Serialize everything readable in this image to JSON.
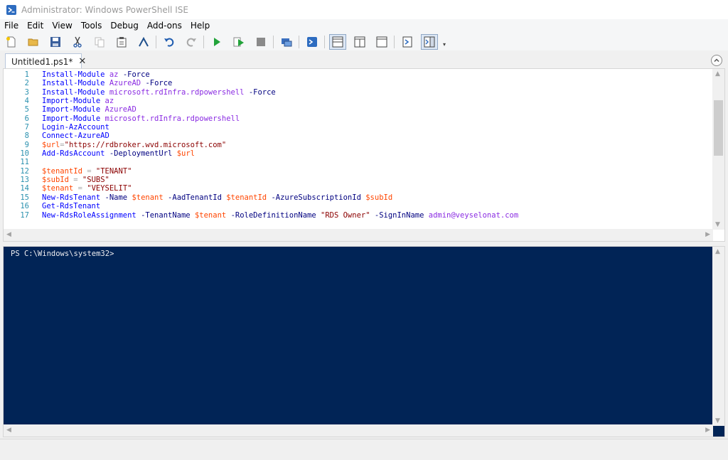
{
  "window": {
    "title": "Administrator: Windows PowerShell ISE"
  },
  "menu": [
    "File",
    "Edit",
    "View",
    "Tools",
    "Debug",
    "Add-ons",
    "Help"
  ],
  "toolbar": {
    "buttons": [
      "new-icon",
      "open-icon",
      "save-icon",
      "cut-icon",
      "copy-icon",
      "paste-icon",
      "clear-icon",
      "undo-icon",
      "redo-icon",
      "run-icon",
      "run-selection-icon",
      "stop-icon",
      "remote-icon",
      "powershell-icon",
      "layout-top-icon",
      "layout-right-icon",
      "layout-max-icon",
      "show-addon-icon",
      "show-commands-icon"
    ]
  },
  "tab": {
    "label": "Untitled1.ps1*",
    "close": "✕"
  },
  "editor": {
    "line_numbers": [
      "1",
      "2",
      "3",
      "4",
      "5",
      "6",
      "7",
      "8",
      "9",
      "10",
      "11",
      "12",
      "13",
      "14",
      "15",
      "16",
      "17"
    ],
    "lines": [
      "Install-Module az -Force",
      "Install-Module AzureAD -Force",
      "Install-Module microsoft.rdInfra.rdpowershell -Force",
      "Import-Module az",
      "Import-Module AzureAD",
      "Import-Module microsoft.rdInfra.rdpowershell",
      "Login-AzAccount",
      "Connect-AzureAD",
      "$url=\"https://rdbroker.wvd.microsoft.com\"",
      "Add-RdsAccount -DeploymentUrl $url",
      "",
      "$tenantId = \"TENANT\"",
      "$subId = \"SUBS\"",
      "$tenant = \"VEYSELIT\"",
      "New-RdsTenant -Name $tenant -AadTenantId $tenantId -AzureSubscriptionId $subId",
      "Get-RdsTenant",
      "New-RdsRoleAssignment -TenantName $tenant -RoleDefinitionName \"RDS Owner\" -SignInName admin@veyselonat.com"
    ]
  },
  "console": {
    "prompt": "PS C:\\Windows\\system32>"
  },
  "colors": {
    "console_bg": "#012456",
    "cmdlet": "#0000ff",
    "argument": "#8a2be2",
    "parameter": "#000080",
    "variable": "#ff4500",
    "string": "#8b0000"
  }
}
